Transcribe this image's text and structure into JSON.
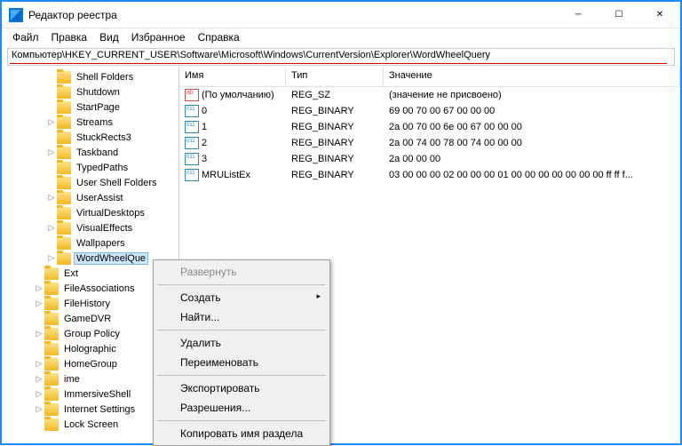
{
  "window": {
    "title": "Редактор реестра"
  },
  "menu": {
    "file": "Файл",
    "edit": "Правка",
    "view": "Вид",
    "favorites": "Избранное",
    "help": "Справка"
  },
  "path": "Компьютер\\HKEY_CURRENT_USER\\Software\\Microsoft\\Windows\\CurrentVersion\\Explorer\\WordWheelQuery",
  "tree": [
    {
      "label": "Shell Folders",
      "indent": 50,
      "exp": ""
    },
    {
      "label": "Shutdown",
      "indent": 50,
      "exp": ""
    },
    {
      "label": "StartPage",
      "indent": 50,
      "exp": ""
    },
    {
      "label": "Streams",
      "indent": 50,
      "exp": ">"
    },
    {
      "label": "StuckRects3",
      "indent": 50,
      "exp": ""
    },
    {
      "label": "Taskband",
      "indent": 50,
      "exp": ">"
    },
    {
      "label": "TypedPaths",
      "indent": 50,
      "exp": ""
    },
    {
      "label": "User Shell Folders",
      "indent": 50,
      "exp": ""
    },
    {
      "label": "UserAssist",
      "indent": 50,
      "exp": ">"
    },
    {
      "label": "VirtualDesktops",
      "indent": 50,
      "exp": ""
    },
    {
      "label": "VisualEffects",
      "indent": 50,
      "exp": ">"
    },
    {
      "label": "Wallpapers",
      "indent": 50,
      "exp": ""
    },
    {
      "label": "WordWheelQue",
      "indent": 50,
      "exp": ">",
      "selected": true
    },
    {
      "label": "Ext",
      "indent": 36,
      "exp": ""
    },
    {
      "label": "FileAssociations",
      "indent": 36,
      "exp": ">"
    },
    {
      "label": "FileHistory",
      "indent": 36,
      "exp": ">"
    },
    {
      "label": "GameDVR",
      "indent": 36,
      "exp": ""
    },
    {
      "label": "Group Policy",
      "indent": 36,
      "exp": ">"
    },
    {
      "label": "Holographic",
      "indent": 36,
      "exp": ""
    },
    {
      "label": "HomeGroup",
      "indent": 36,
      "exp": ">"
    },
    {
      "label": "ime",
      "indent": 36,
      "exp": ">"
    },
    {
      "label": "ImmersiveShell",
      "indent": 36,
      "exp": ">"
    },
    {
      "label": "Internet Settings",
      "indent": 36,
      "exp": ">"
    },
    {
      "label": "Lock Screen",
      "indent": 36,
      "exp": ""
    }
  ],
  "columns": {
    "name": "Имя",
    "type": "Тип",
    "data": "Значение"
  },
  "values": [
    {
      "name": "(По умолчанию)",
      "type": "REG_SZ",
      "data": "(значение не присвоено)",
      "icon": "sz"
    },
    {
      "name": "0",
      "type": "REG_BINARY",
      "data": "69 00 70 00 67 00 00 00",
      "icon": "bin"
    },
    {
      "name": "1",
      "type": "REG_BINARY",
      "data": "2a 00 70 00 6e 00 67 00 00 00",
      "icon": "bin"
    },
    {
      "name": "2",
      "type": "REG_BINARY",
      "data": "2a 00 74 00 78 00 74 00 00 00",
      "icon": "bin"
    },
    {
      "name": "3",
      "type": "REG_BINARY",
      "data": "2a 00 00 00",
      "icon": "bin"
    },
    {
      "name": "MRUListEx",
      "type": "REG_BINARY",
      "data": "03 00 00 00 02 00 00 00 01 00 00 00 00 00 00 00 ff ff f...",
      "icon": "bin"
    }
  ],
  "ctx": {
    "expand": "Развернуть",
    "new": "Создать",
    "find": "Найти...",
    "delete": "Удалить",
    "rename": "Переименовать",
    "export": "Экспортировать",
    "perms": "Разрешения...",
    "copyname": "Копировать имя раздела"
  }
}
